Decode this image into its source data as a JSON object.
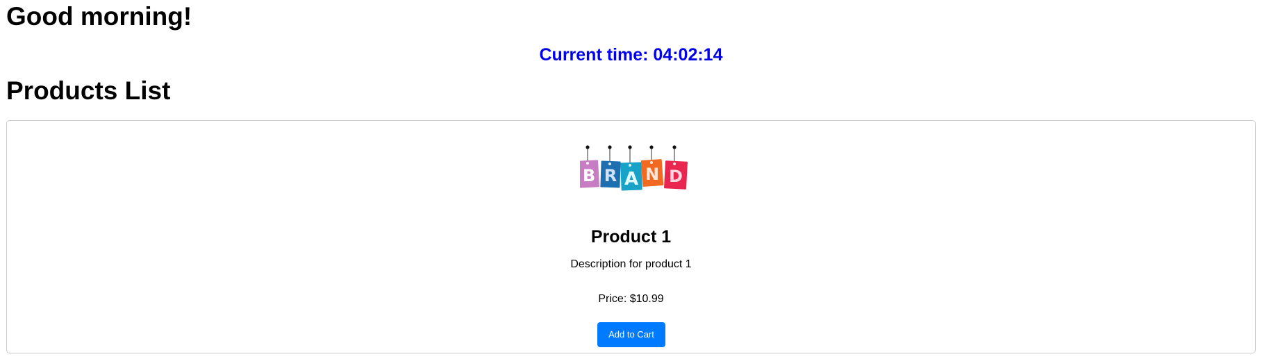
{
  "greeting": "Good morning!",
  "clock": {
    "text": "Current time: 04:02:14",
    "color": "#0000ee"
  },
  "products_section": {
    "title": "Products List"
  },
  "products": [
    {
      "image_label": "BRAND",
      "image_letters": [
        "B",
        "R",
        "A",
        "N",
        "D"
      ],
      "tag_colors": [
        "#c77dc4",
        "#1e6fb0",
        "#16a3c7",
        "#f26a21",
        "#e8264f"
      ],
      "name": "Product 1",
      "description": "Description for product 1",
      "price": "Price: $10.99",
      "button_label": "Add to Cart",
      "button_color": "#007bff"
    }
  ]
}
